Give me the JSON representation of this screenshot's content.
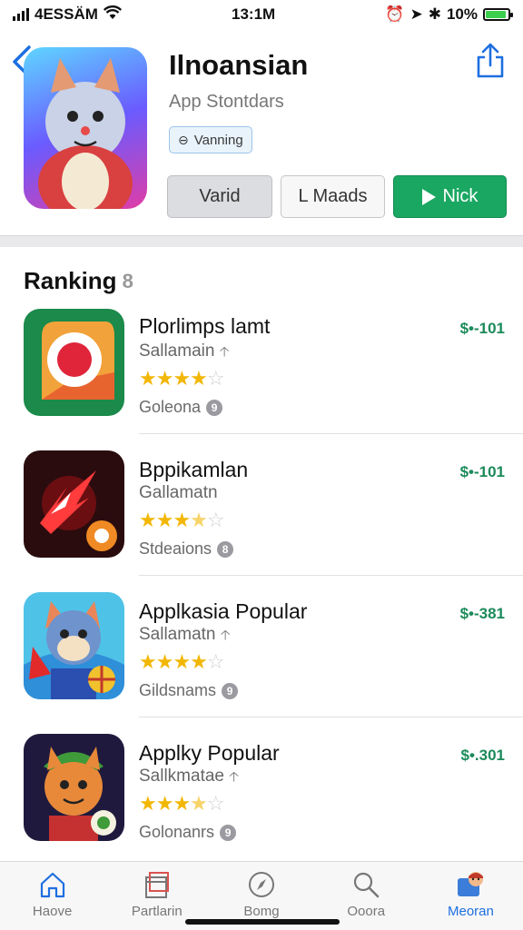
{
  "status_bar": {
    "carrier": "4ESSÄΜ",
    "time": "13:1M",
    "battery": "10%",
    "battery_level": 0.9
  },
  "app": {
    "title": "Ilnoansian",
    "subtitle": "App Stontdars",
    "badge": "Vanning",
    "buttons": {
      "vand": "Varid",
      "maads": "L Maads",
      "nick": "Nick"
    }
  },
  "ranking": {
    "title": "Ranking",
    "count": "8",
    "items": [
      {
        "name": "Plorlimps lamt",
        "developer": "Sallamain",
        "rating": 4,
        "category": "Goleona",
        "category_badge": "9",
        "price": "$•-101"
      },
      {
        "name": "Bppikamlan",
        "developer": "Gallamatn",
        "rating": 3.5,
        "category": "Stdeaions",
        "category_badge": "8",
        "price": "$•-101"
      },
      {
        "name": "Applkasia Popular",
        "developer": "Sallamatn",
        "rating": 4,
        "category": "Gildsnams",
        "category_badge": "9",
        "price": "$•-381"
      },
      {
        "name": "Applky Popular",
        "developer": "Sallkmatae",
        "rating": 3.5,
        "category": "Golonanrs",
        "category_badge": "9",
        "price": "$•.301"
      }
    ]
  },
  "tabs": [
    {
      "label": "Haove",
      "icon": "home-icon",
      "active": false
    },
    {
      "label": "Partlarin",
      "icon": "games-icon",
      "active": false
    },
    {
      "label": "Bomg",
      "icon": "compass-icon",
      "active": false
    },
    {
      "label": "Ooora",
      "icon": "search-icon",
      "active": false
    },
    {
      "label": "Meoran",
      "icon": "profile-icon",
      "active": true
    }
  ],
  "colors": {
    "accent": "#1d6fe0",
    "green": "#1aa762",
    "star": "#f2b705"
  }
}
